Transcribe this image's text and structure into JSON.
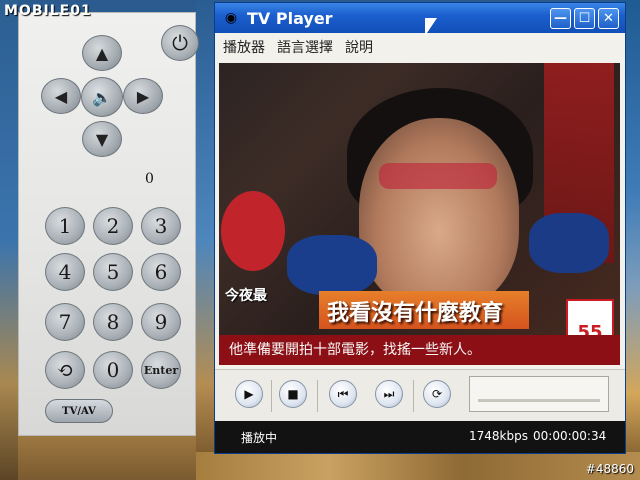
{
  "watermark": {
    "top": "MOBILE01",
    "bottom": "#48860"
  },
  "remote": {
    "power_icon": "power-icon",
    "dpad": {
      "up": "▲",
      "down": "▼",
      "left": "◀",
      "right": "▶",
      "center_icon": "speaker-icon"
    },
    "channel_readout": "0",
    "keys": [
      "1",
      "2",
      "3",
      "4",
      "5",
      "6",
      "7",
      "8",
      "9"
    ],
    "zero": "0",
    "enter_label": "Enter",
    "tv_av_label": "TV/AV"
  },
  "player": {
    "title": "TV Player",
    "menu": [
      "播放器",
      "語言選擇",
      "說明"
    ],
    "window_buttons": {
      "minimize": "—",
      "maximize": "☐",
      "close": "✕"
    },
    "video": {
      "headline": "我看沒有什麼教育",
      "caption": "他準備要開拍十部電影，找搖一些新人。",
      "tonight": "今夜最",
      "channel_logo": "55"
    },
    "status": {
      "state": "播放中",
      "bitrate": "1748kbps",
      "time": "00:00:00:34"
    }
  },
  "colors": {
    "titlebar": "#1b5fcf",
    "statusbar": "#121212",
    "headline": "#d4531e"
  }
}
